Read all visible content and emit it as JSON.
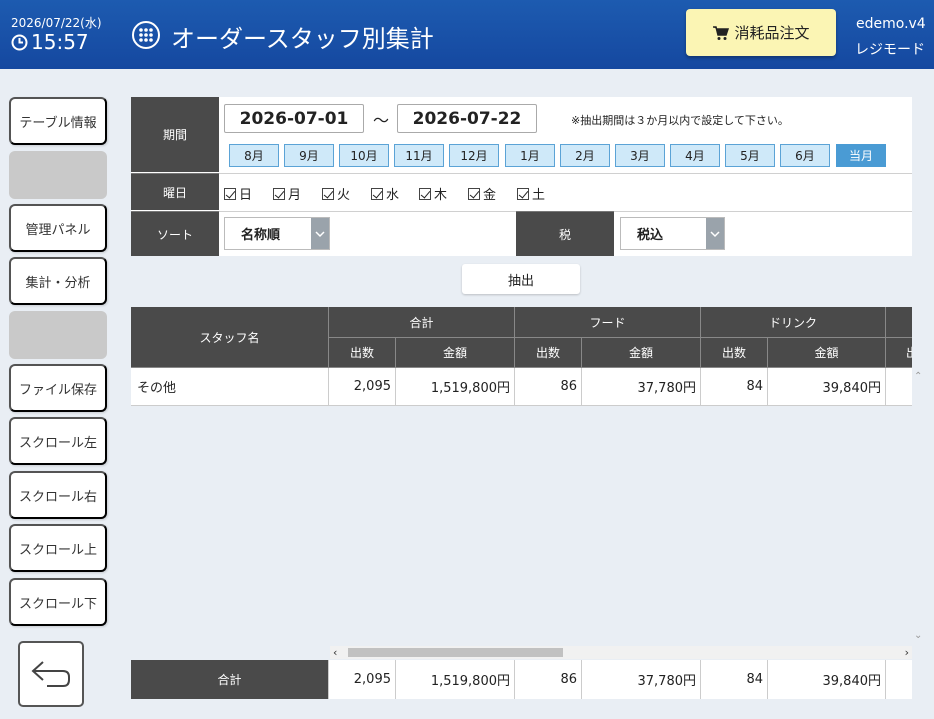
{
  "header": {
    "date": "2026/07/22(水)",
    "time": "15:57",
    "title": "オーダースタッフ別集計",
    "order_button": "消耗品注文",
    "app_version": "edemo.v4",
    "mode": "レジモード"
  },
  "sidebar": {
    "items": [
      "テーブル情報",
      "",
      "管理パネル",
      "集計・分析",
      "",
      "ファイル保存",
      "スクロール左",
      "スクロール右",
      "スクロール上",
      "スクロール下"
    ]
  },
  "filter": {
    "period_label": "期間",
    "date_from": "2026-07-01",
    "tilde": "～",
    "date_to": "2026-07-22",
    "note": "※抽出期間は３か月以内で設定して下さい。",
    "months": [
      "8月",
      "9月",
      "10月",
      "11月",
      "12月",
      "1月",
      "2月",
      "3月",
      "4月",
      "5月",
      "6月",
      "当月"
    ],
    "weekday_label": "曜日",
    "weekdays": [
      "日",
      "月",
      "火",
      "水",
      "木",
      "金",
      "土"
    ],
    "sort_label": "ソート",
    "sort_value": "名称順",
    "tax_label": "税",
    "tax_value": "税込",
    "extract_button": "抽出"
  },
  "table": {
    "staff_header": "スタッフ名",
    "groups": [
      "合計",
      "フード",
      "ドリンク"
    ],
    "sub_count": "出数",
    "sub_amount": "金額",
    "sub_partial": "出",
    "rows": [
      {
        "name": "その他",
        "total_count": "2,095",
        "total_amount": "1,519,800円",
        "food_count": "86",
        "food_amount": "37,780円",
        "drink_count": "84",
        "drink_amount": "39,840円"
      }
    ]
  },
  "totals": {
    "label": "合計",
    "total_count": "2,095",
    "total_amount": "1,519,800円",
    "food_count": "86",
    "food_amount": "37,780円",
    "drink_count": "84",
    "drink_amount": "39,840円"
  },
  "colors": {
    "header_bg": "#1d5bb0",
    "order_btn": "#fbf5b4",
    "month_btn": "#cfe9f9",
    "month_active": "#4a9bd4",
    "table_header": "#4a4a4a"
  }
}
